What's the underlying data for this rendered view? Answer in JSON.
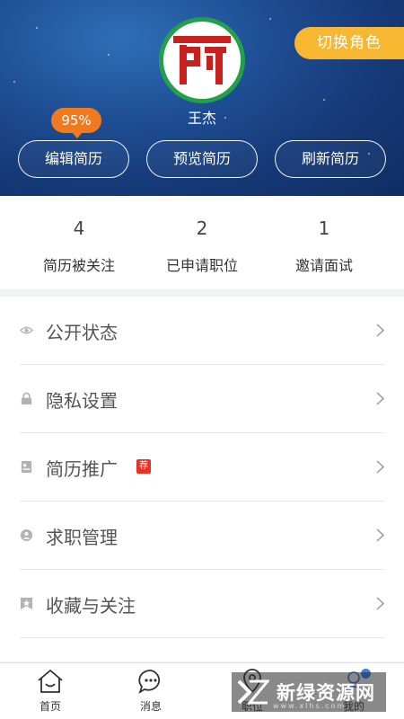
{
  "header": {
    "switch_role_label": "切换角色",
    "user_name": "王杰",
    "progress_label": "95%",
    "progress_value": 0.95,
    "buttons": [
      "编辑简历",
      "预览简历",
      "刷新简历"
    ],
    "colors": {
      "accent": "#f17a1e",
      "switch": "#f7b731",
      "avatar_ring": "#22a04b",
      "logo_red": "#c8201f"
    }
  },
  "stats": [
    {
      "value": "4",
      "label": "简历被关注"
    },
    {
      "value": "2",
      "label": "已申请职位"
    },
    {
      "value": "1",
      "label": "邀请面试"
    }
  ],
  "menu": [
    {
      "label": "公开状态",
      "icon": "eye-icon"
    },
    {
      "label": "隐私设置",
      "icon": "lock-icon"
    },
    {
      "label": "简历推广",
      "icon": "resume-icon",
      "tag": "荐"
    },
    {
      "label": "求职管理",
      "icon": "user-circle-icon"
    },
    {
      "label": "收藏与关注",
      "icon": "star-box-icon"
    }
  ],
  "tabbar": [
    {
      "label": "首页",
      "icon": "home-icon"
    },
    {
      "label": "消息",
      "icon": "chat-icon"
    },
    {
      "label": "职位",
      "icon": "location-icon"
    },
    {
      "label": "我的",
      "icon": "profile-icon"
    }
  ],
  "watermark": {
    "text": "新绿资源网",
    "sub": "www.xlhs.com"
  }
}
